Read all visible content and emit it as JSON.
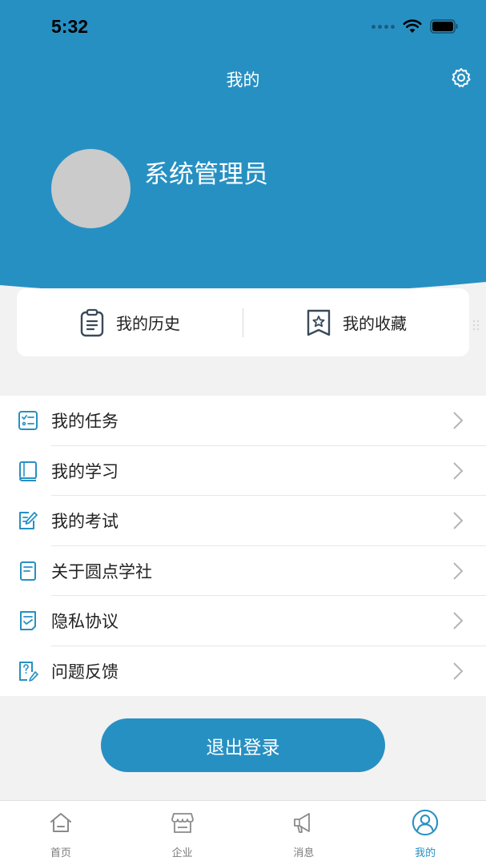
{
  "status_bar": {
    "time": "5:32"
  },
  "header": {
    "title": "我的",
    "username": "系统管理员"
  },
  "colors": {
    "primary": "#2790c3",
    "background": "#f2f2f2",
    "avatar": "#cbcbcb"
  },
  "quick_links": [
    {
      "label": "我的历史",
      "icon": "clipboard-icon"
    },
    {
      "label": "我的收藏",
      "icon": "bookmark-star-icon"
    }
  ],
  "menu": [
    {
      "label": "我的任务",
      "icon": "task-list-icon"
    },
    {
      "label": "我的学习",
      "icon": "book-icon"
    },
    {
      "label": "我的考试",
      "icon": "exam-edit-icon"
    },
    {
      "label": "关于圆点学社",
      "icon": "document-icon"
    },
    {
      "label": "隐私协议",
      "icon": "agreement-icon"
    },
    {
      "label": "问题反馈",
      "icon": "feedback-icon"
    }
  ],
  "logout_label": "退出登录",
  "tabs": [
    {
      "label": "首页",
      "icon": "home-icon",
      "active": false
    },
    {
      "label": "企业",
      "icon": "store-icon",
      "active": false
    },
    {
      "label": "消息",
      "icon": "megaphone-icon",
      "active": false
    },
    {
      "label": "我的",
      "icon": "user-circle-icon",
      "active": true
    }
  ]
}
